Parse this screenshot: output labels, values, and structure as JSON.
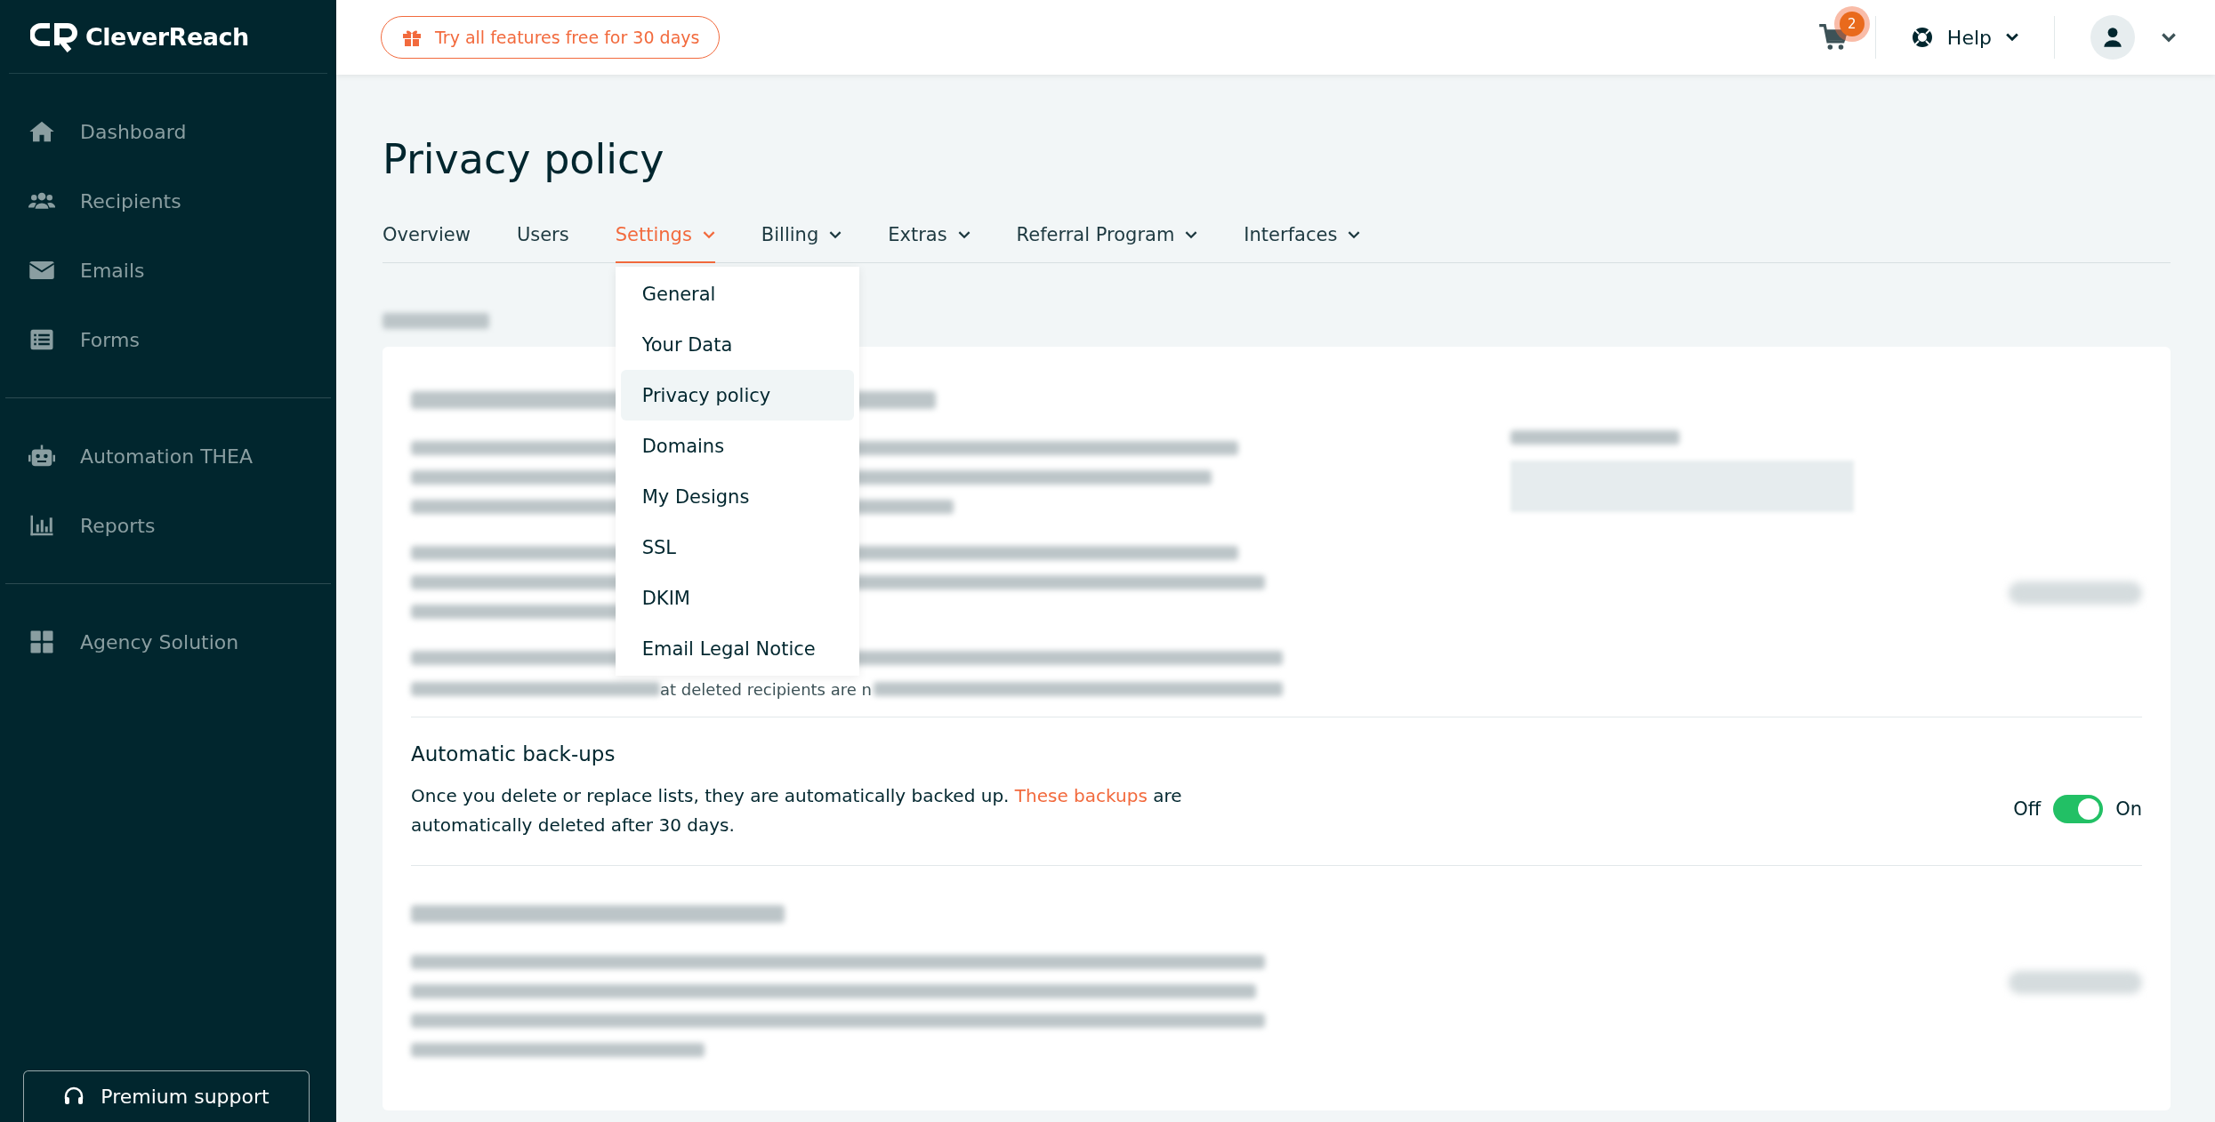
{
  "brand": {
    "name": "CleverReach"
  },
  "sidebar": {
    "sections": [
      [
        {
          "label": "Dashboard"
        },
        {
          "label": "Recipients"
        },
        {
          "label": "Emails"
        },
        {
          "label": "Forms"
        }
      ],
      [
        {
          "label": "Automation THEA"
        },
        {
          "label": "Reports"
        }
      ],
      [
        {
          "label": "Agency Solution"
        }
      ]
    ],
    "support_button": "Premium support"
  },
  "topbar": {
    "promo": "Try all features free for 30 days",
    "cart_count": "2",
    "help": "Help"
  },
  "page": {
    "title": "Privacy policy",
    "tabs": [
      {
        "label": "Overview",
        "selected": false,
        "has_menu": false
      },
      {
        "label": "Users",
        "selected": false,
        "has_menu": false
      },
      {
        "label": "Settings",
        "selected": true,
        "has_menu": true
      },
      {
        "label": "Billing",
        "selected": false,
        "has_menu": true
      },
      {
        "label": "Extras",
        "selected": false,
        "has_menu": true
      },
      {
        "label": "Referral Program",
        "selected": false,
        "has_menu": true
      },
      {
        "label": "Interfaces",
        "selected": false,
        "has_menu": true
      }
    ]
  },
  "settings_menu": {
    "items": [
      {
        "label": "General",
        "selected": false
      },
      {
        "label": "Your Data",
        "selected": false
      },
      {
        "label": "Privacy policy",
        "selected": true
      },
      {
        "label": "Domains",
        "selected": false
      },
      {
        "label": "My Designs",
        "selected": false
      },
      {
        "label": "SSL",
        "selected": false
      },
      {
        "label": "DKIM",
        "selected": false
      },
      {
        "label": "Email Legal Notice",
        "selected": false
      }
    ]
  },
  "visible_fragment": "at deleted recipients are n",
  "backups": {
    "title": "Automatic back-ups",
    "text_before": "Once you delete or replace lists, they are automatically backed up. ",
    "link": "These backups",
    "text_after": " are automatically deleted after 30 days.",
    "toggle": {
      "off_label": "Off",
      "on_label": "On",
      "on": true
    }
  }
}
